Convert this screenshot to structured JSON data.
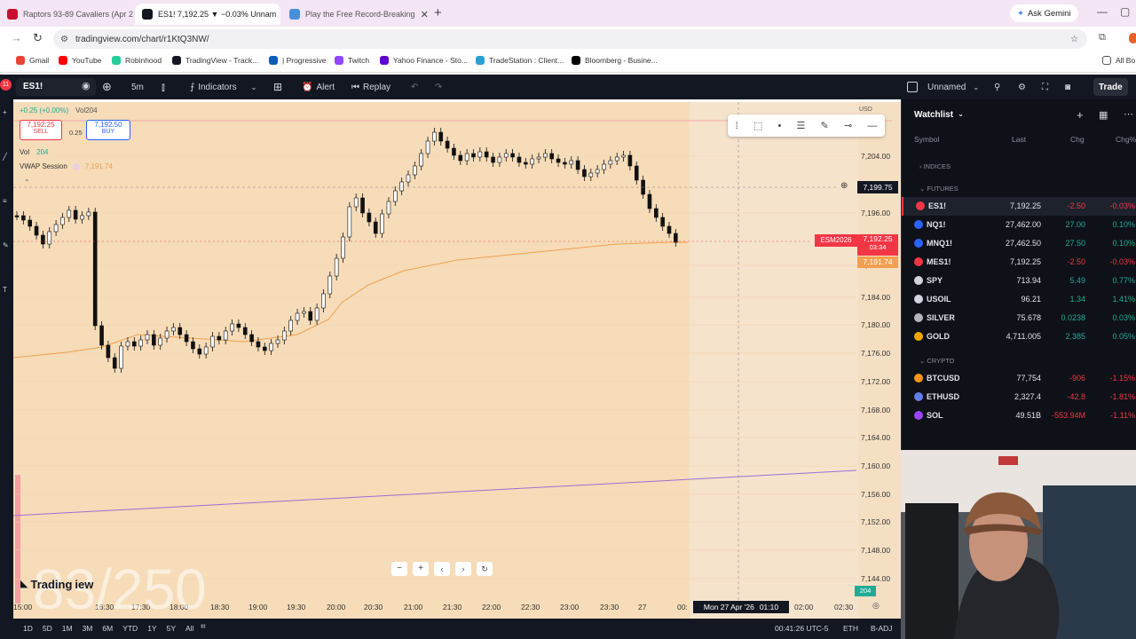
{
  "browser": {
    "tabs": [
      {
        "title": "Raptors 93-89 Cavaliers (Apr 26",
        "active": false
      },
      {
        "title": "ES1! 7,192.25 ▼ −0.03% Unnam",
        "active": true
      },
      {
        "title": "Play the Free Record-Breaking",
        "active": false
      }
    ],
    "new_tab": "+",
    "ask_gemini": "Ask Gemini",
    "url": "tradingview.com/chart/r1KtQ3NW/",
    "bookmarks": [
      {
        "label": "Gmail",
        "color": "#ea4335"
      },
      {
        "label": "YouTube",
        "color": "#ff0000"
      },
      {
        "label": "Robinhood",
        "color": "#21ce99"
      },
      {
        "label": "TradingView - Track...",
        "color": "#131722"
      },
      {
        "label": "| Progressive",
        "color": "#0c5cb9"
      },
      {
        "label": "Twitch",
        "color": "#9146ff"
      },
      {
        "label": "Yahoo Finance - Sto...",
        "color": "#6001d2"
      },
      {
        "label": "TradeStation : Client...",
        "color": "#2a9fd8"
      },
      {
        "label": "Bloomberg - Busine...",
        "color": "#000000"
      }
    ],
    "all_bookmarks": "All Bo"
  },
  "header": {
    "symbol": "ES1!",
    "interval": "5m",
    "indicators": "Indicators",
    "alert": "Alert",
    "replay": "Replay",
    "layout_name": "Unnamed",
    "trade": "Trade"
  },
  "legend": {
    "change": "+0.25 (+0.00%)",
    "vol_inline": "Vol",
    "vol_value": "204",
    "sell_price": "7,192.25",
    "sell": "SELL",
    "spread": "0.25",
    "buy_price": "7,192.50",
    "buy": "BUY",
    "vol_label": "Vol",
    "vol_label_value": "204",
    "vwap_label": "VWAP Session",
    "vwap_value": "7,191.74"
  },
  "chart_data": {
    "type": "candlestick",
    "price_axis": [
      "7,204.00",
      "7,196.00",
      "7,188.00",
      "7,184.00",
      "7,180.00",
      "7,176.00",
      "7,172.00",
      "7,168.00",
      "7,164.00",
      "7,160.00",
      "7,156.00",
      "7,152.00",
      "7,148.00",
      "7,144.00"
    ],
    "time_axis": [
      "15:00",
      "16:30",
      "17:30",
      "18:00",
      "18:30",
      "19:00",
      "19:30",
      "20:00",
      "20:30",
      "21:00",
      "21:30",
      "22:00",
      "22:30",
      "23:00",
      "23:30",
      "27",
      "00:",
      "02:00",
      "02:30"
    ],
    "crosshair_price": "7,199.75",
    "crosshair_time": "Mon 27 Apr '26",
    "crosshair_time_extra": "01:10",
    "last_symbol": "ESM2026",
    "last_price": "7,192.25",
    "countdown": "03:34",
    "vwap_price_label": "7,191.74",
    "volume_badge": "204",
    "currency": "USD",
    "watermark": "83/250",
    "logo_text": "Trading",
    "logo_text2": "iew"
  },
  "bottom": {
    "ranges": [
      "1D",
      "5D",
      "1M",
      "3M",
      "6M",
      "YTD",
      "1Y",
      "5Y",
      "All"
    ],
    "clock": "00:41:26 UTC-5",
    "session": "ETH",
    "adj": "B-ADJ"
  },
  "watchlist": {
    "title": "Watchlist",
    "columns": [
      "Symbol",
      "Last",
      "Chg",
      "Chg%"
    ],
    "sections": {
      "indices": "INDICES",
      "futures": "FUTURES",
      "crypto": "CRYPTO"
    },
    "futures": [
      {
        "symbol": "ES1!",
        "last": "7,192.25",
        "chg": "-2.50",
        "chgp": "-0.03%",
        "dir": "neg",
        "color": "#f23645"
      },
      {
        "symbol": "NQ1!",
        "last": "27,462.00",
        "chg": "27.00",
        "chgp": "0.10%",
        "dir": "pos",
        "color": "#2962ff"
      },
      {
        "symbol": "MNQ1!",
        "last": "27,462.50",
        "chg": "27.50",
        "chgp": "0.10%",
        "dir": "pos",
        "color": "#2962ff"
      },
      {
        "symbol": "MES1!",
        "last": "7,192.25",
        "chg": "-2.50",
        "chgp": "-0.03%",
        "dir": "neg",
        "color": "#f23645"
      },
      {
        "symbol": "SPY",
        "last": "713.94",
        "chg": "5.49",
        "chgp": "0.77%",
        "dir": "pos",
        "color": "#d1d4dc"
      },
      {
        "symbol": "USOIL",
        "last": "96.21",
        "chg": "1.34",
        "chgp": "1.41%",
        "dir": "pos",
        "color": "#d1d4dc"
      },
      {
        "symbol": "SILVER",
        "last": "75.678",
        "chg": "0.0238",
        "chgp": "0.03%",
        "dir": "pos",
        "color": "#b2b5be"
      },
      {
        "symbol": "GOLD",
        "last": "4,711.005",
        "chg": "2.385",
        "chgp": "0.05%",
        "dir": "pos",
        "color": "#f7a600"
      }
    ],
    "crypto": [
      {
        "symbol": "BTCUSD",
        "last": "77,754",
        "chg": "-906",
        "chgp": "-1.15%",
        "dir": "neg",
        "color": "#f7931a"
      },
      {
        "symbol": "ETHUSD",
        "last": "2,327.4",
        "chg": "-42.8",
        "chgp": "-1.81%",
        "dir": "neg",
        "color": "#627eea"
      },
      {
        "symbol": "SOL",
        "last": "49.51B",
        "chg": "-553.94M",
        "chgp": "-1.11%",
        "dir": "neg",
        "color": "#9945ff"
      }
    ]
  }
}
